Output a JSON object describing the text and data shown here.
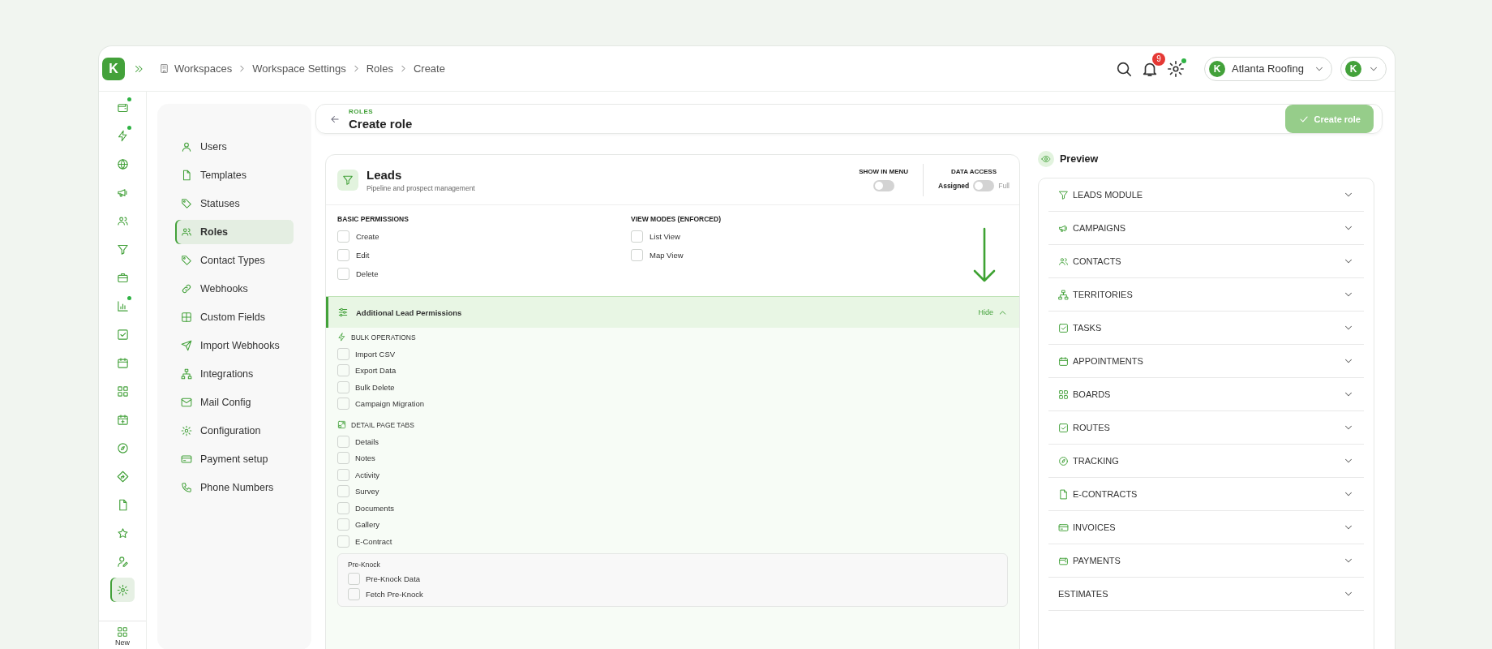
{
  "rail": {
    "logo": "K",
    "items": [
      {
        "kind": "wallet",
        "badge": true,
        "selected": false
      },
      {
        "kind": "bolt",
        "badge": true,
        "selected": false
      },
      {
        "kind": "globe",
        "badge": false,
        "selected": false
      },
      {
        "kind": "megaphone",
        "badge": false,
        "selected": false
      },
      {
        "kind": "users",
        "badge": false,
        "selected": false
      },
      {
        "kind": "funnel",
        "badge": false,
        "selected": false
      },
      {
        "kind": "briefcase",
        "badge": false,
        "selected": false
      },
      {
        "kind": "chart",
        "badge": true,
        "selected": false
      },
      {
        "kind": "check",
        "badge": false,
        "selected": false
      },
      {
        "kind": "calendar",
        "badge": false,
        "selected": false
      },
      {
        "kind": "grid",
        "badge": false,
        "selected": false
      },
      {
        "kind": "calendar-plus",
        "badge": false,
        "selected": false
      },
      {
        "kind": "compass",
        "badge": false,
        "selected": false
      },
      {
        "kind": "route",
        "badge": false,
        "selected": false
      },
      {
        "kind": "file",
        "badge": false,
        "selected": false
      },
      {
        "kind": "star",
        "badge": false,
        "selected": false
      },
      {
        "kind": "user-pen",
        "badge": false,
        "selected": false
      },
      {
        "kind": "gear",
        "badge": false,
        "selected": true
      }
    ],
    "new_label": "New"
  },
  "breadcrumb": [
    "Workspaces",
    "Workspace Settings",
    "Roles",
    "Create"
  ],
  "topbar": {
    "notifications": "9",
    "settings_badge": true,
    "workspace": {
      "logo": "K",
      "name": "Atlanta Roofing"
    },
    "account": {
      "logo": "K"
    }
  },
  "settings_nav": [
    {
      "label": "Users",
      "kind": "user",
      "selected": false
    },
    {
      "label": "Templates",
      "kind": "file",
      "selected": false
    },
    {
      "label": "Statuses",
      "kind": "tag",
      "selected": false
    },
    {
      "label": "Roles",
      "kind": "users",
      "selected": true
    },
    {
      "label": "Contact Types",
      "kind": "tag",
      "selected": false
    },
    {
      "label": "Webhooks",
      "kind": "link",
      "selected": false
    },
    {
      "label": "Custom Fields",
      "kind": "table",
      "selected": false
    },
    {
      "label": "Import Webhooks",
      "kind": "send",
      "selected": false
    },
    {
      "label": "Integrations",
      "kind": "network",
      "selected": false
    },
    {
      "label": "Mail Config",
      "kind": "mail",
      "selected": false
    },
    {
      "label": "Configuration",
      "kind": "gear",
      "selected": false
    },
    {
      "label": "Payment setup",
      "kind": "card",
      "selected": false
    },
    {
      "label": "Phone Numbers",
      "kind": "phone",
      "selected": false
    }
  ],
  "header": {
    "eyebrow": "ROLES",
    "title": "Create role",
    "action": "Create role"
  },
  "module": {
    "title": "Leads",
    "subtitle": "Pipeline and prospect management",
    "show_in_menu": {
      "label": "SHOW IN MENU",
      "on": false
    },
    "data_access": {
      "label": "DATA ACCESS",
      "left": "Assigned",
      "right": "Full",
      "on": false
    },
    "basic": {
      "title": "BASIC PERMISSIONS",
      "items": [
        {
          "label": "Create",
          "checked": false
        },
        {
          "label": "Edit",
          "checked": false
        },
        {
          "label": "Delete",
          "checked": false
        }
      ]
    },
    "view_modes": {
      "title": "VIEW MODES (ENFORCED)",
      "items": [
        {
          "label": "List View",
          "checked": false
        },
        {
          "label": "Map View",
          "checked": false
        }
      ]
    },
    "additional": {
      "title": "Additional Lead Permissions",
      "toggle": "Hide",
      "expanded": true,
      "groups": [
        {
          "title": "BULK OPERATIONS",
          "kind": "bolt",
          "items": [
            {
              "label": "Import CSV",
              "checked": false
            },
            {
              "label": "Export Data",
              "checked": false
            },
            {
              "label": "Bulk Delete",
              "checked": false
            },
            {
              "label": "Campaign Migration",
              "checked": false
            }
          ]
        },
        {
          "title": "DETAIL PAGE TABS",
          "kind": "external",
          "items": [
            {
              "label": "Details",
              "checked": false
            },
            {
              "label": "Notes",
              "checked": false
            },
            {
              "label": "Activity",
              "checked": false
            },
            {
              "label": "Survey",
              "checked": false
            },
            {
              "label": "Documents",
              "checked": false
            },
            {
              "label": "Gallery",
              "checked": false
            },
            {
              "label": "E-Contract",
              "checked": false
            }
          ]
        }
      ],
      "subgroup": {
        "title": "Pre-Knock",
        "items": [
          {
            "label": "Pre-Knock Data",
            "checked": false
          },
          {
            "label": "Fetch Pre-Knock",
            "checked": false
          }
        ]
      }
    }
  },
  "preview": {
    "title": "Preview",
    "items": [
      {
        "label": "LEADS MODULE",
        "kind": "funnel",
        "expanded": false
      },
      {
        "label": "CAMPAIGNS",
        "kind": "megaphone",
        "expanded": false
      },
      {
        "label": "CONTACTS",
        "kind": "users",
        "expanded": false
      },
      {
        "label": "TERRITORIES",
        "kind": "network",
        "expanded": false
      },
      {
        "label": "TASKS",
        "kind": "check",
        "expanded": false
      },
      {
        "label": "APPOINTMENTS",
        "kind": "calendar",
        "expanded": false
      },
      {
        "label": "BOARDS",
        "kind": "grid",
        "expanded": false
      },
      {
        "label": "ROUTES",
        "kind": "check",
        "expanded": false
      },
      {
        "label": "TRACKING",
        "kind": "compass",
        "expanded": false
      },
      {
        "label": "E-CONTRACTS",
        "kind": "file",
        "expanded": false
      },
      {
        "label": "INVOICES",
        "kind": "card",
        "expanded": false
      },
      {
        "label": "PAYMENTS",
        "kind": "wallet",
        "expanded": false
      },
      {
        "label": "ESTIMATES",
        "expanded": false
      }
    ]
  }
}
